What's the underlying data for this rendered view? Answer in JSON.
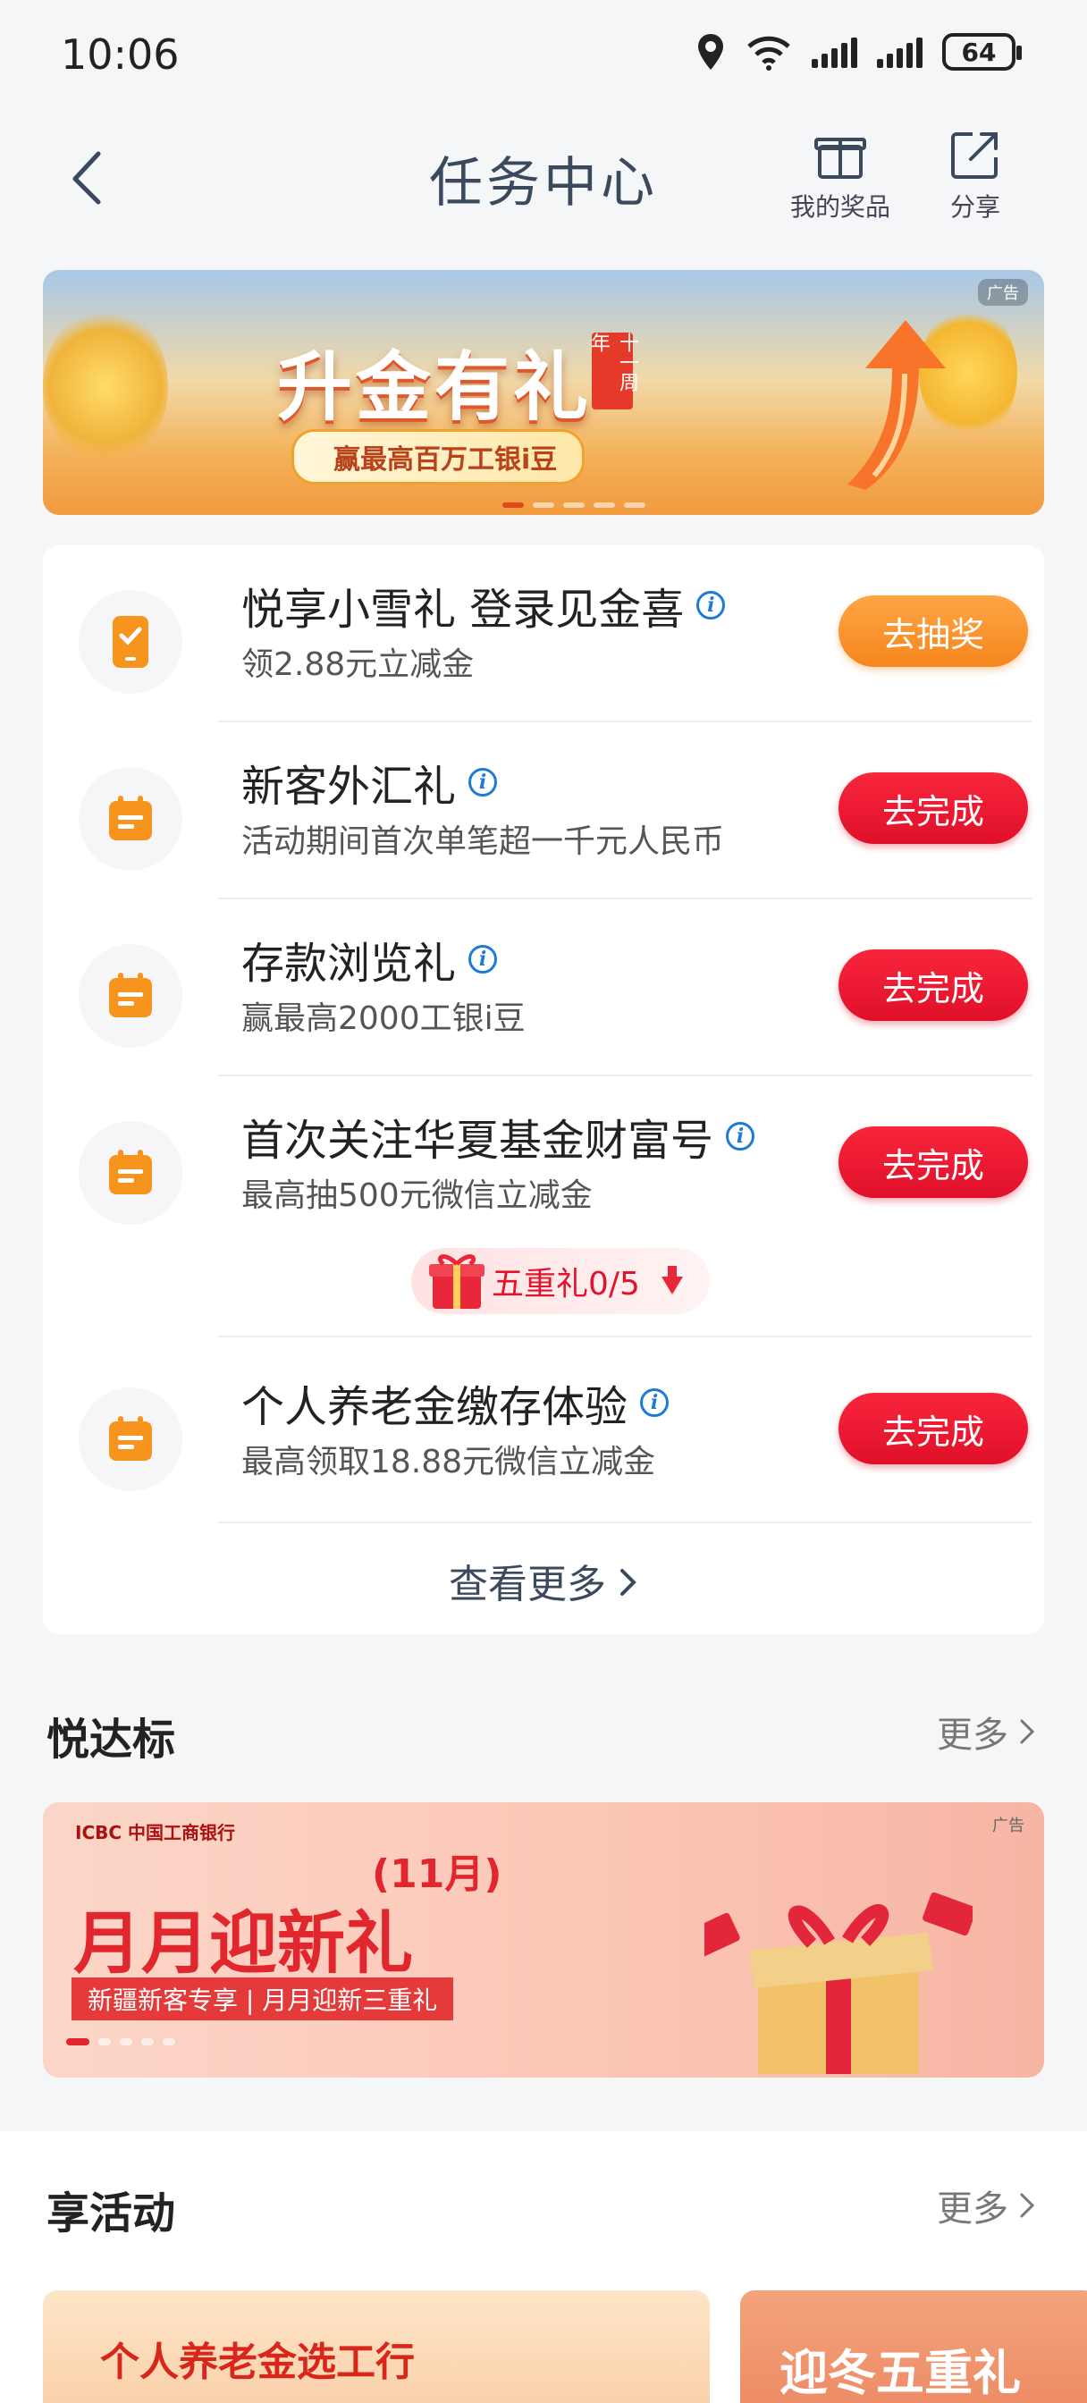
{
  "status_bar": {
    "time": "10:06",
    "battery": "64",
    "network": "6"
  },
  "nav": {
    "title": "任务中心",
    "prizes_label": "我的奖品",
    "share_label": "分享"
  },
  "top_banner": {
    "headline": "升金有礼",
    "seal": "十一周年",
    "pill": "赢最高百万工银i豆",
    "ad_tag": "广告"
  },
  "tasks": [
    {
      "title": "悦享小雪礼 登录见金喜",
      "subtitle": "领2.88元立减金",
      "button": "去抽奖",
      "button_color": "#f5861c"
    },
    {
      "title": "新客外汇礼",
      "subtitle": "活动期间首次单笔超一千元人民币",
      "button": "去完成",
      "button_color": "#e0102a"
    },
    {
      "title": "存款浏览礼",
      "subtitle": "赢最高2000工银i豆",
      "button": "去完成",
      "button_color": "#e0102a"
    },
    {
      "title": "首次关注华夏基金财富号",
      "subtitle": "最高抽500元微信立减金",
      "button": "去完成",
      "button_color": "#e0102a"
    },
    {
      "title": "个人养老金缴存体验",
      "subtitle": "最高领取18.88元微信立减金",
      "button": "去完成",
      "button_color": "#e0102a"
    }
  ],
  "gift_chip": {
    "label": "五重礼0/5"
  },
  "see_more": "查看更多",
  "section_yuedabiao": {
    "title": "悦达标",
    "more": "更多"
  },
  "banner2": {
    "bank": "ICBC 中国工商银行",
    "ad_tag": "广告",
    "headline": "月月迎新礼",
    "month": "(11月)",
    "sub": "新疆新客专享 | 月月迎新三重礼"
  },
  "section_xianghuodong": {
    "title": "享活动",
    "more": "更多"
  },
  "activity_cards": [
    {
      "text": "个人养老金选工行"
    },
    {
      "text": "迎冬五重礼"
    }
  ]
}
